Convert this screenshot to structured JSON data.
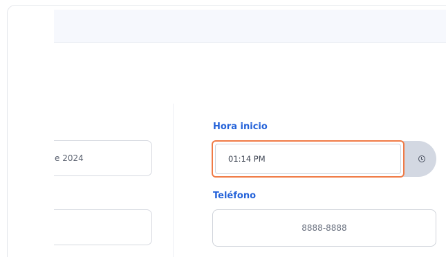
{
  "form": {
    "fecha_value_partial": "e 2024",
    "second_left_value": "",
    "hora_inicio": {
      "label": "Hora inicio",
      "value": "01:14 PM",
      "addon_icon": "clock-icon"
    },
    "telefono": {
      "label": "Teléfono",
      "placeholder": "8888-8888",
      "value": ""
    }
  },
  "colors": {
    "label_blue": "#2563d9",
    "focus_orange": "#f07a45",
    "addon_gray": "#d3d8e2",
    "topbar_bg": "#f6f8fd"
  }
}
